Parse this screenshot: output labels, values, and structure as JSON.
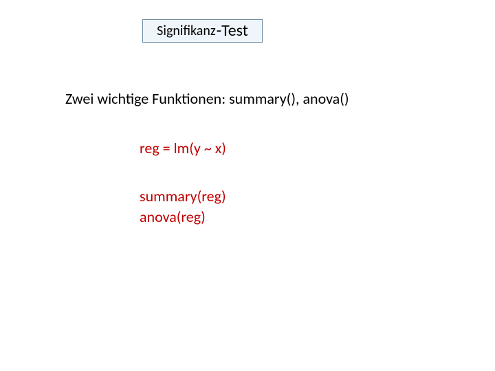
{
  "title": {
    "part1": "Signifikanz",
    "part2": "-Test"
  },
  "intro": "Zwei wichtige Funktionen: summary(), anova()",
  "code": {
    "line1": "reg = lm(y ~ x)",
    "line2": "summary(reg)",
    "line3": "anova(reg)"
  }
}
